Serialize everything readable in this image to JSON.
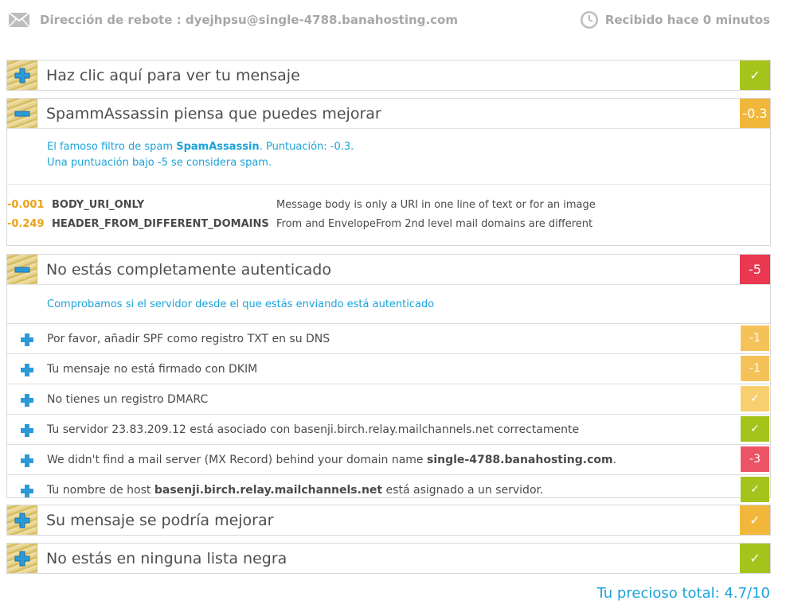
{
  "header": {
    "bounce_label": "Dirección de rebote : dyejhpsu@single-4788.banahosting.com",
    "received_label": "Recibido hace 0 minutos"
  },
  "sections": [
    {
      "title": "Haz clic aquí para ver tu mensaje",
      "score": "✓",
      "color": "green",
      "icon": "plus-icon"
    },
    {
      "title": "SpammAssassin piensa que puedes mejorar",
      "score": "-0.3",
      "color": "orange",
      "icon": "minus-icon",
      "intro_line1_pre": "El famoso filtro de spam ",
      "intro_line1_bold": "SpamAssassin",
      "intro_line1_post": ". Puntuación: -0.3.",
      "intro_line2": "Una puntuación bajo -5 se considera spam.",
      "rules": [
        {
          "score": "-0.001",
          "name": "BODY_URI_ONLY",
          "desc": "Message body is only a URI in one line of text or for an image"
        },
        {
          "score": "-0.249",
          "name": "HEADER_FROM_DIFFERENT_DOMAINS",
          "desc": "From and EnvelopeFrom 2nd level mail domains are different"
        }
      ]
    },
    {
      "title": "No estás completamente autenticado",
      "score": "-5",
      "color": "red",
      "icon": "minus-icon",
      "intro": "Comprobamos si el servidor desde el que estás enviando está autenticado",
      "items": [
        {
          "pre": "Por favor, añadir SPF como registro TXT en su DNS",
          "bold": "",
          "post": "",
          "score": "-1",
          "color": "orange"
        },
        {
          "pre": "Tu mensaje no está firmado con DKIM",
          "bold": "",
          "post": "",
          "score": "-1",
          "color": "orange"
        },
        {
          "pre": "No tienes un registro DMARC",
          "bold": "",
          "post": "",
          "score": "✓",
          "color": "lightorange"
        },
        {
          "pre": "Tu servidor 23.83.209.12 está asociado con basenji.birch.relay.mailchannels.net correctamente",
          "bold": "",
          "post": "",
          "score": "✓",
          "color": "green"
        },
        {
          "pre": "We didn't find a mail server (MX Record) behind your domain name ",
          "bold": "single-4788.banahosting.com",
          "post": ".",
          "score": "-3",
          "color": "red"
        },
        {
          "pre": "Tu nombre de host ",
          "bold": "basenji.birch.relay.mailchannels.net",
          "post": " está asignado a un servidor.",
          "score": "✓",
          "color": "green"
        }
      ]
    },
    {
      "title": "Su mensaje se podría mejorar",
      "score": "✓",
      "color": "orange",
      "icon": "plus-icon"
    },
    {
      "title": "No estás en ninguna lista negra",
      "score": "✓",
      "color": "green",
      "icon": "plus-icon"
    }
  ],
  "total_label": "Tu precioso total: 4.7/10",
  "colors": {
    "green": "#a5c41b",
    "orange": "#f0b73a",
    "red": "#e9384f",
    "blue": "#1aa3d9"
  }
}
